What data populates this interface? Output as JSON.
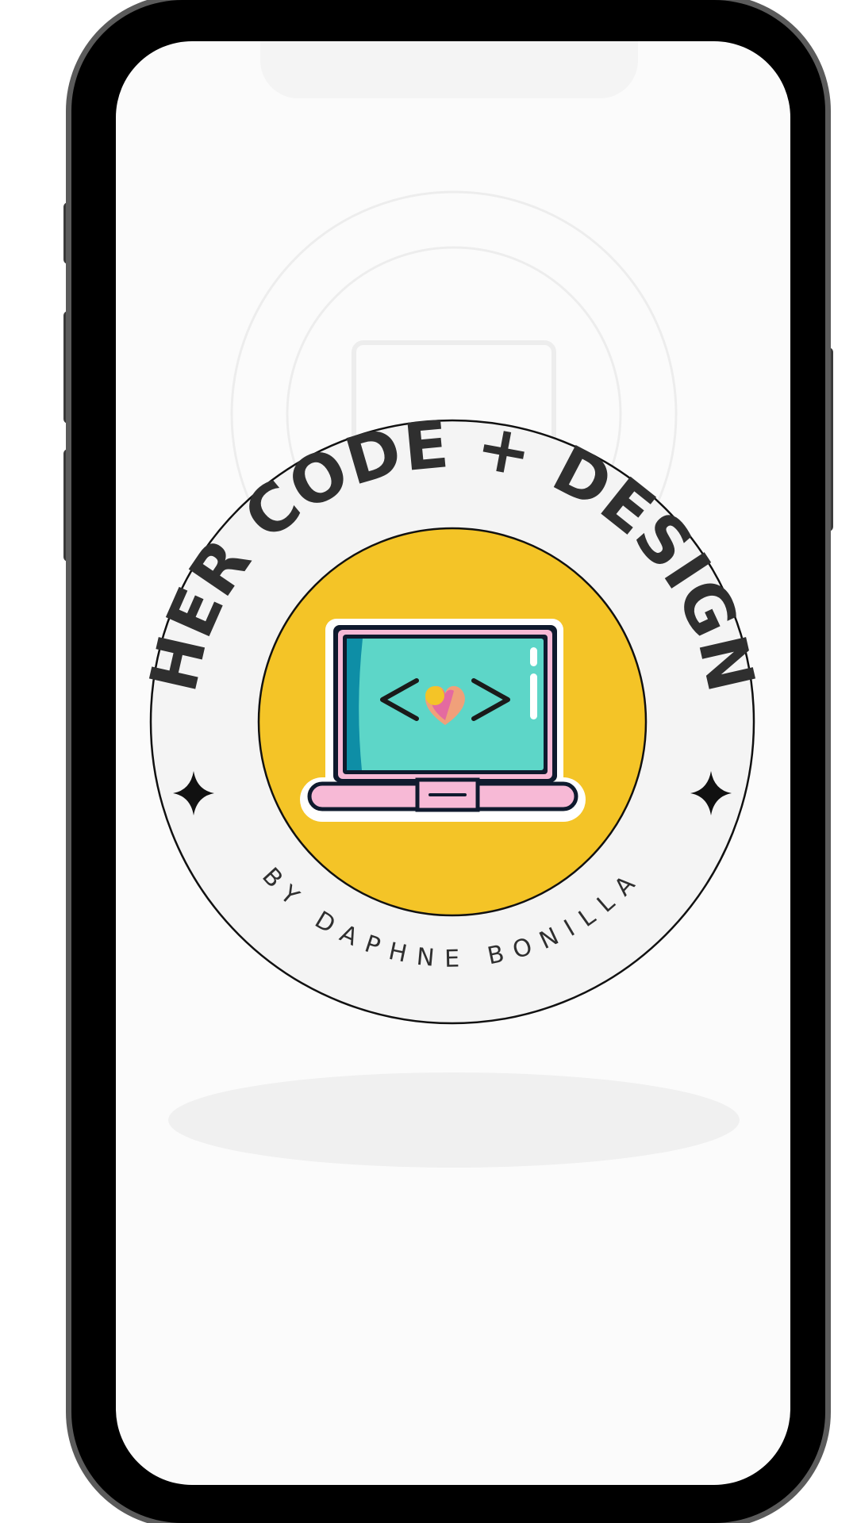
{
  "badge": {
    "title": "HER CODE + DESIGN",
    "subtitle": "BY DAPHNE BONILLA",
    "code_symbol_left": "<",
    "code_symbol_right": ">"
  },
  "colors": {
    "ring": "#f4f4f4",
    "center": "#f4c427",
    "screen": "#5dd6c8",
    "screen_shadow": "#0e8ea6",
    "laptop_frame": "#0f1a2e",
    "laptop_pink": "#f7b9d6",
    "heart_yellow": "#f4c427",
    "heart_pink": "#e46aa0",
    "heart_peach": "#f0a07a"
  },
  "icons": [
    "laptop-icon",
    "heart-icon",
    "sparkle-icon"
  ]
}
